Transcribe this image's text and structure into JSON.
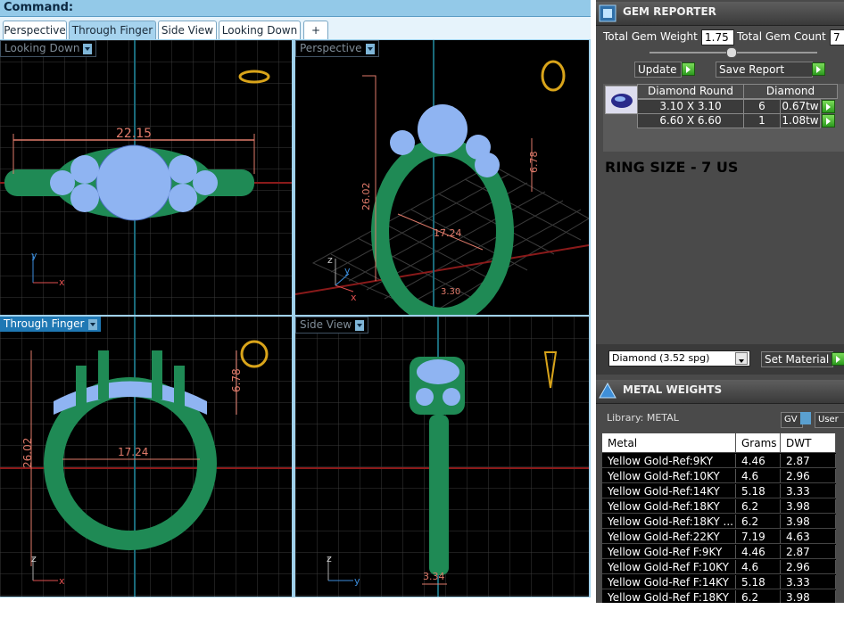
{
  "command": {
    "label": "Command:"
  },
  "tabs": [
    "Perspective",
    "Through Finger",
    "Side View",
    "Looking Down"
  ],
  "tab_add_symbol": "+",
  "viewports": {
    "top_left": {
      "label": "Looking Down",
      "dim": "22.15"
    },
    "top_right": {
      "label": "Perspective",
      "dim_height": "26.02",
      "dim_width": "17.24",
      "dim_side": "6.78",
      "dim_shank": "3.30"
    },
    "bottom_left": {
      "label": "Through Finger",
      "dim_height": "26.02",
      "dim_width": "17.24",
      "dim_top": "6.78"
    },
    "bottom_right": {
      "label": "Side View",
      "dim_shank": "3.34"
    }
  },
  "axis_labels": {
    "x": "x",
    "y": "y",
    "z": "z"
  },
  "gem_reporter": {
    "title": "GEM REPORTER",
    "total_weight_label": "Total Gem Weight",
    "total_weight": "1.75",
    "total_count_label": "Total Gem Count",
    "total_count": "7",
    "update_label": "Update",
    "save_label": "Save Report",
    "table_header_shape": "Diamond Round",
    "table_header_material": "Diamond",
    "rows": [
      {
        "size": "3.10 X 3.10",
        "count": "6",
        "weight": "0.67tw"
      },
      {
        "size": "6.60 X 6.60",
        "count": "1",
        "weight": "1.08tw"
      }
    ],
    "ring_size": "RING SIZE -  7 US",
    "material_select": "Diamond     (3.52 spg)",
    "set_material_label": "Set Material"
  },
  "metal_weights": {
    "title": "METAL WEIGHTS",
    "library_label": "Library: METAL",
    "gv_label": "GV",
    "user_label": "User",
    "headers": [
      "Metal",
      "Grams",
      "DWT"
    ],
    "rows": [
      [
        "Yellow Gold-Ref:9KY",
        "4.46",
        "2.87"
      ],
      [
        "Yellow Gold-Ref:10KY",
        "4.6",
        "2.96"
      ],
      [
        "Yellow Gold-Ref:14KY",
        "5.18",
        "3.33"
      ],
      [
        "Yellow Gold-Ref:18KY",
        "6.2",
        "3.98"
      ],
      [
        "Yellow Gold-Ref:18KY ...",
        "6.2",
        "3.98"
      ],
      [
        "Yellow Gold-Ref:22KY",
        "7.19",
        "4.63"
      ],
      [
        "Yellow Gold-Ref F:9KY",
        "4.46",
        "2.87"
      ],
      [
        "Yellow Gold-Ref F:10KY",
        "4.6",
        "2.96"
      ],
      [
        "Yellow Gold-Ref F:14KY",
        "5.18",
        "3.33"
      ],
      [
        "Yellow Gold-Ref F:18KY",
        "6.2",
        "3.98"
      ]
    ]
  },
  "colors": {
    "ring": "#1f8a55",
    "gem": "#8fb4f2",
    "dimension": "#e07a6a",
    "grid": "#3a3a3a"
  }
}
